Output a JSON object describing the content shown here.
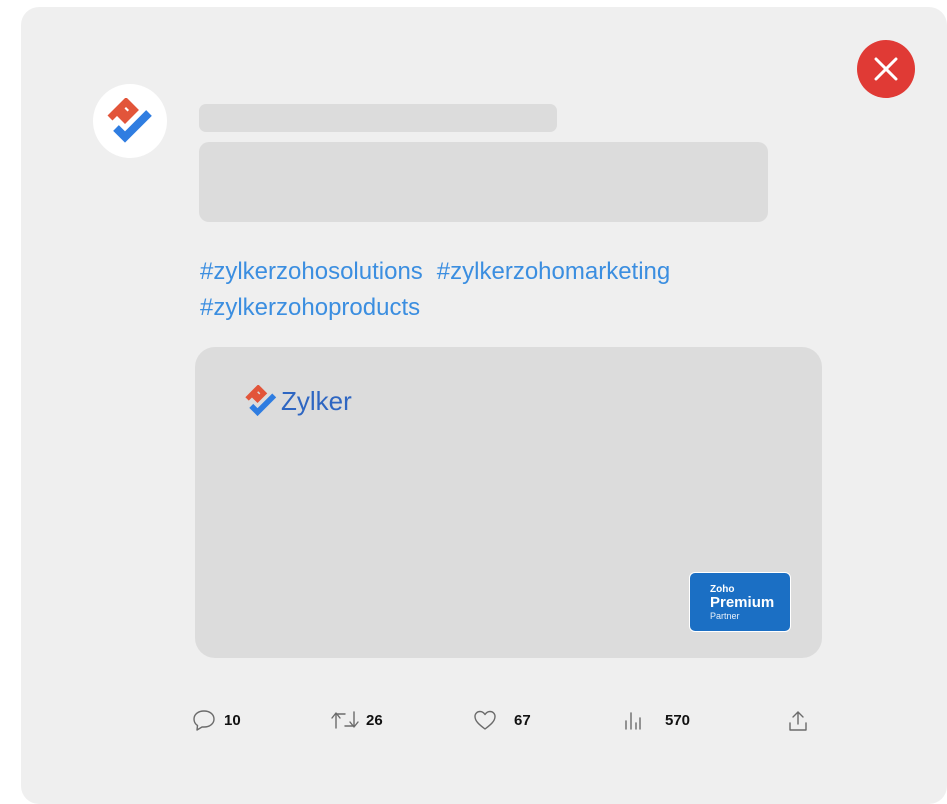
{
  "post": {
    "hashtags": [
      "#zylkerzohosolutions",
      "#zylkerzohomarketing",
      "#zylkerzohoproducts"
    ]
  },
  "media": {
    "brand_name": "Zylker",
    "badge": {
      "top": "Zoho",
      "middle": "Premium",
      "bottom": "Partner"
    }
  },
  "actions": {
    "replies": "10",
    "reposts": "26",
    "likes": "67",
    "views": "570"
  },
  "colors": {
    "close": "#e03a35",
    "hashtag": "#3b8ee0",
    "brand_text": "#2e66c2",
    "badge": "#1b6fc4",
    "logo_orange": "#e2553a",
    "logo_blue": "#2f7de1"
  },
  "icons": [
    "close-icon",
    "zylker-logo-icon",
    "reply-icon",
    "repost-icon",
    "like-icon",
    "views-icon",
    "share-icon"
  ]
}
